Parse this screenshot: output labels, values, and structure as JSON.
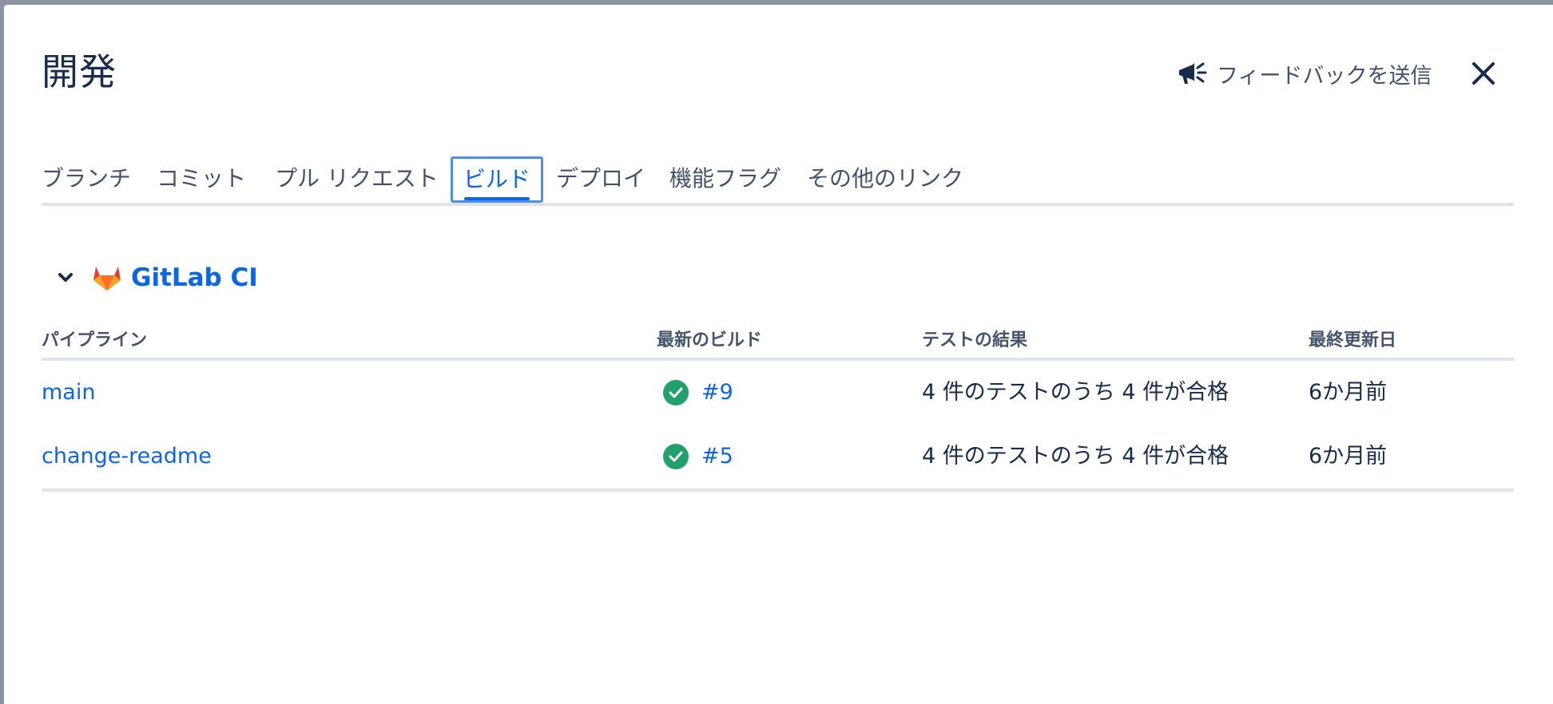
{
  "modal": {
    "title": "開発",
    "feedback_label": "フィードバックを送信",
    "close_icon": "close-icon",
    "feedback_icon": "megaphone-icon"
  },
  "tabs": [
    {
      "label": "ブランチ"
    },
    {
      "label": "コミット"
    },
    {
      "label": "プル リクエスト"
    },
    {
      "label": "ビルド"
    },
    {
      "label": "デプロイ"
    },
    {
      "label": "機能フラグ"
    },
    {
      "label": "その他のリンク"
    }
  ],
  "selected_tab": "ビルド",
  "group": {
    "name": "GitLab CI",
    "icon": "gitlab-logo-icon",
    "expanded": true
  },
  "table": {
    "headers": {
      "pipeline": "パイプライン",
      "latest_build": "最新のビルド",
      "test_results": "テストの結果",
      "last_updated": "最終更新日"
    },
    "rows": [
      {
        "pipeline": "main",
        "build": "#9",
        "status": "success",
        "tests": "4 件のテストのうち 4 件が合格",
        "updated": "6か月前"
      },
      {
        "pipeline": "change-readme",
        "build": "#5",
        "status": "success",
        "tests": "4 件のテストのうち 4 件が合格",
        "updated": "6か月前"
      }
    ]
  },
  "colors": {
    "accent": "#0c66e4",
    "success": "#22a06b",
    "text": "#172b4d",
    "subtle_text": "#42526e",
    "backdrop": "#8c93a3"
  }
}
